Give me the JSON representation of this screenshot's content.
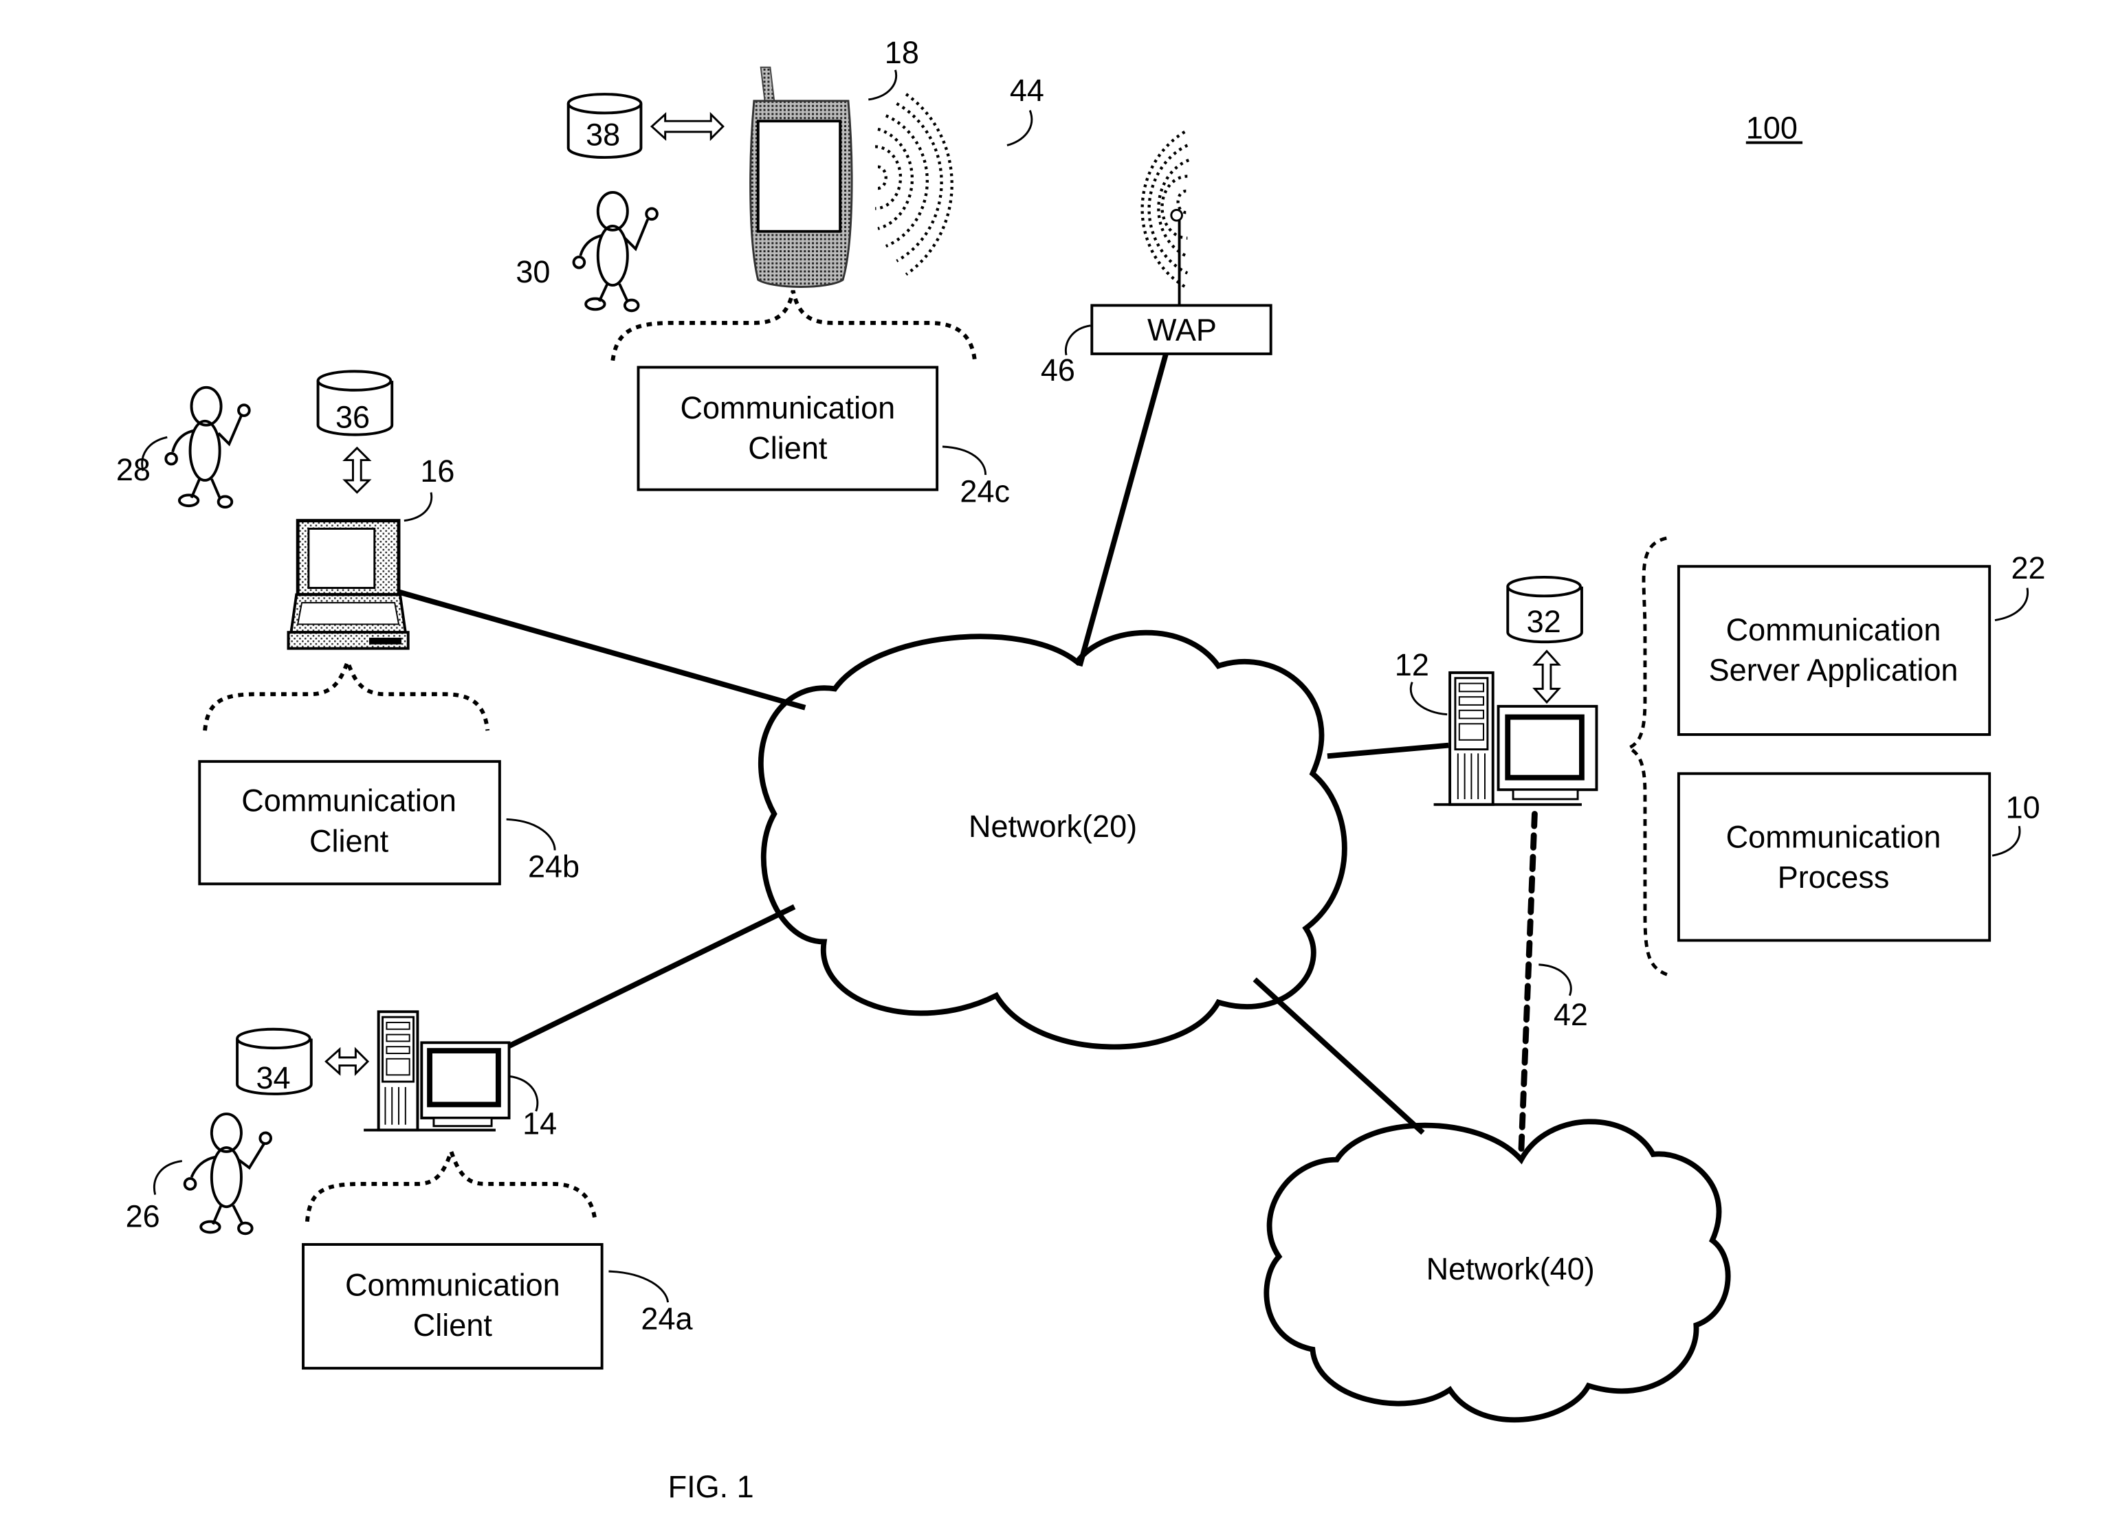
{
  "figure": {
    "title": "FIG. 1",
    "reference": "100"
  },
  "colors": {
    "ink": "#000000",
    "paper": "#ffffff",
    "stipple": "#9a9a9a"
  },
  "networks": [
    {
      "id": "network-20",
      "label": "Network(20)"
    },
    {
      "id": "network-40",
      "label": "Network(40)"
    }
  ],
  "server": {
    "ref": "12",
    "datastore": "32",
    "boxes": [
      {
        "ref": "22",
        "line1": "Communication",
        "line2": "Server Application"
      },
      {
        "ref": "10",
        "line1": "Communication",
        "line2": "Process"
      }
    ],
    "link_to_network40_ref": "42"
  },
  "clients": [
    {
      "device": "desktop",
      "device_ref": "14",
      "user_ref": "26",
      "datastore": "34",
      "box": {
        "ref": "24a",
        "line1": "Communication",
        "line2": "Client"
      }
    },
    {
      "device": "laptop",
      "device_ref": "16",
      "user_ref": "28",
      "datastore": "36",
      "box": {
        "ref": "24b",
        "line1": "Communication",
        "line2": "Client"
      }
    },
    {
      "device": "smartphone",
      "device_ref": "18",
      "user_ref": "30",
      "datastore": "38",
      "box": {
        "ref": "24c",
        "line1": "Communication",
        "line2": "Client"
      }
    }
  ],
  "wireless": {
    "signal_ref": "44",
    "access_point": {
      "label": "WAP",
      "ref": "46"
    }
  }
}
